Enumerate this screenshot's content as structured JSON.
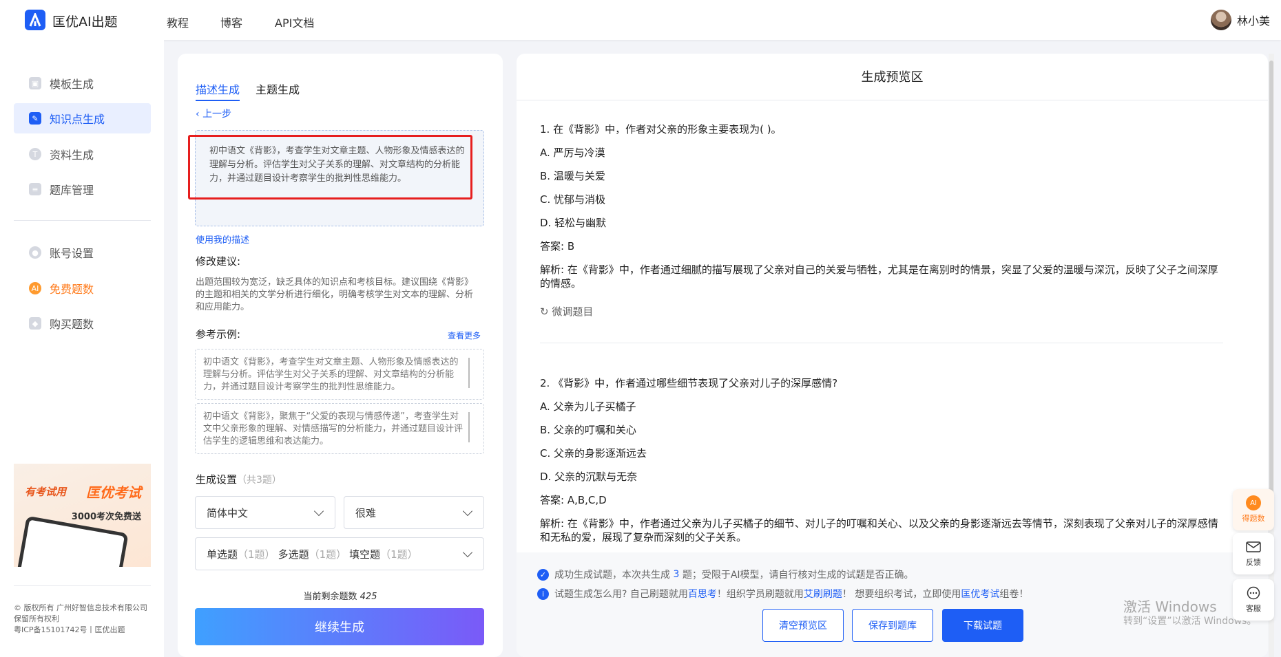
{
  "header": {
    "brand": "匡优AI出题",
    "nav": [
      "教程",
      "博客",
      "API文档"
    ],
    "user_name": "林小美"
  },
  "sidebar": {
    "items": [
      {
        "label": "模板生成",
        "icon": "template-icon"
      },
      {
        "label": "知识点生成",
        "icon": "pen-icon",
        "active": true
      },
      {
        "label": "资料生成",
        "icon": "text-icon"
      },
      {
        "label": "题库管理",
        "icon": "library-icon"
      },
      {
        "label": "账号设置",
        "icon": "user-icon"
      },
      {
        "label": "免费题数",
        "icon": "ai-icon"
      },
      {
        "label": "购买题数",
        "icon": "diamond-icon"
      }
    ],
    "promo": {
      "tag": "有考试用",
      "brand": "匡优考试",
      "text": "3000考次免费送"
    },
    "footer": {
      "line1": "© 版权所有 广州好智信息技术有限公司",
      "line2": "保留所有权利",
      "line3": "粤ICP备15101742号丨匡优出题"
    }
  },
  "left_panel": {
    "tabs": [
      "描述生成",
      "主题生成"
    ],
    "back": "上一步",
    "description": "初中语文《背影》，考查学生对文章主题、人物形象及情感表达的理解与分析。评估学生对父子关系的理解、对文章结构的分析能力，并通过题目设计考察学生的批判性思维能力。",
    "use_my_desc": "使用我的描述",
    "suggestion_title": "修改建议:",
    "suggestion": "出题范围较为宽泛，缺乏具体的知识点和考核目标。建议围绕《背影》的主题和相关的文学分析进行细化，明确考核学生对文本的理解、分析和应用能力。",
    "examples_title": "参考示例:",
    "more": "查看更多",
    "examples": [
      "初中语文《背影》，考查学生对文章主题、人物形象及情感表达的理解与分析。评估学生对父子关系的理解、对文章结构的分析能力，并通过题目设计考察学生的批判性思维能力。",
      "初中语文《背影》，聚焦于“父爱的表现与情感传递”，考查学生对文中父亲形象的理解、对情感描写的分析能力，并通过题目设计评估学生的逻辑思维和表达能力。"
    ],
    "settings_title": "生成设置",
    "settings_count": "（共3题）",
    "language": "简体中文",
    "difficulty": "很难",
    "types": [
      {
        "name": "单选题",
        "count": "（1题）"
      },
      {
        "name": "多选题",
        "count": "（1题）"
      },
      {
        "name": "填空题",
        "count": "（1题）"
      }
    ],
    "remain_label": "当前剩余题数",
    "remain_value": "425",
    "continue": "继续生成"
  },
  "preview": {
    "title": "生成预览区",
    "q1": {
      "question": "1. 在《背影》中，作者对父亲的形象主要表现为(   )。",
      "options": [
        "A. 严厉与冷漠",
        "B. 温暖与关爱",
        "C. 忧郁与消极",
        "D. 轻松与幽默"
      ],
      "answer": "答案: B",
      "explanation": "解析: 在《背影》中，作者通过细腻的描写展现了父亲对自己的关爱与牺牲，尤其是在离别时的情景，突显了父爱的温暖与深沉，反映了父子之间深厚的情感。",
      "tune": "微调题目"
    },
    "q2": {
      "question": "2. 《背影》中，作者通过哪些细节表现了父亲对儿子的深厚感情?",
      "options": [
        "A. 父亲为儿子买橘子",
        "B. 父亲的叮嘱和关心",
        "C. 父亲的身影逐渐远去",
        "D. 父亲的沉默与无奈"
      ],
      "answer": "答案: A,B,C,D",
      "explanation": "解析: 在《背影》中，作者通过父亲为儿子买橘子的细节、对儿子的叮嘱和关心、以及父亲的身影逐渐远去等情节，深刻表现了父亲对儿子的深厚感情和无私的爱，展现了复杂而深刻的父子关系。"
    },
    "notice1": {
      "a": "成功生成试题，本次共生成",
      "b": "3",
      "c": "题；受限于AI模型，请自行核对生成的试题是否正确。"
    },
    "notice2": {
      "a": "试题生成怎么用? 自己刷题就用",
      "b": "百思考",
      "c": "！组织学员刷题就用",
      "d": "艾刷刷题",
      "e": "！ 想要组织考试，立即使用",
      "f": "匡优考试",
      "g": "组卷！"
    },
    "buttons": [
      "清空预览区",
      "保存到题库",
      "下载试题"
    ]
  },
  "floating": [
    "得题数",
    "反馈",
    "客服"
  ],
  "watermark": {
    "line1": "激活 Windows",
    "line2": "转到“设置”以激活 Windows。"
  }
}
